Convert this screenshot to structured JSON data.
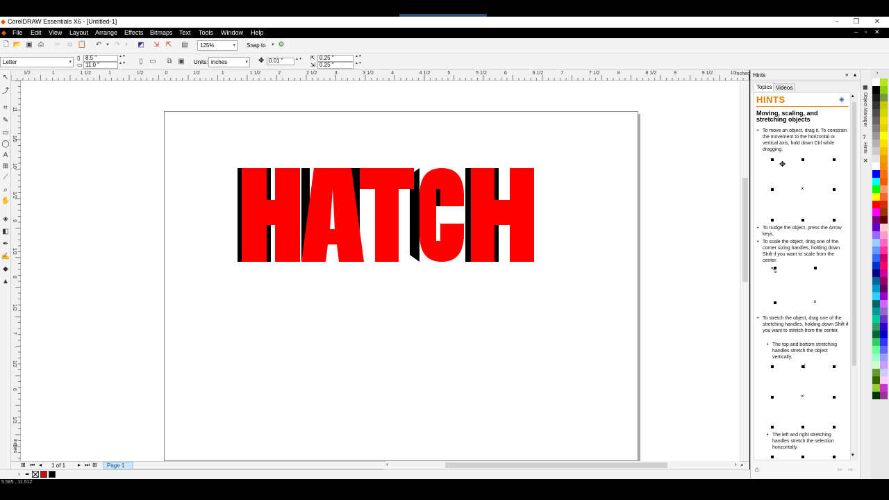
{
  "window": {
    "title": "CorelDRAW Essentials X6 - [Untitled-1]",
    "controls": [
      "–",
      "❐",
      "✕"
    ],
    "doc_controls": [
      "–",
      "▫",
      "✕"
    ]
  },
  "menu": {
    "items": [
      "File",
      "Edit",
      "View",
      "Layout",
      "Arrange",
      "Effects",
      "Bitmaps",
      "Text",
      "Tools",
      "Window",
      "Help"
    ]
  },
  "toolbar": {
    "zoom_value": "125%",
    "snap_to_label": "Snap to"
  },
  "property_bar": {
    "page_size": "Letter",
    "width": "8.5 \"",
    "height": "11.0 \"",
    "units_label": "Units:",
    "units_value": "inches",
    "nudge": "0.01 \"",
    "dup_x": "0.25 \"",
    "dup_y": "0.25 \""
  },
  "ruler": {
    "h_labels": [
      "1/2",
      "1",
      "1 1/2",
      "1",
      "1/2",
      "0",
      "1/2",
      "1",
      "1 1/2",
      "2",
      "2 1/2",
      "3",
      "3 1/2",
      "4",
      "4 1/2",
      "5",
      "5 1/2",
      "6",
      "6 1/2",
      "7",
      "7 1/2",
      "8",
      "8 1/2",
      "9",
      "9 1/2",
      "10"
    ],
    "h_unit": "inches",
    "v_labels": [
      "11",
      "1/2",
      "10",
      "1/2",
      "9",
      "1/2",
      "8",
      "1/2",
      "7",
      "1/2",
      "6",
      "1/2",
      "5"
    ],
    "v_unit": "inches"
  },
  "canvas": {
    "artwork_text": "HATCH",
    "fill_color": "#ff0000",
    "shadow_color": "#000000"
  },
  "page_nav": {
    "page_count": "1 of 1",
    "page_tab": "Page 1"
  },
  "status": {
    "coords": "5.585 , 11.512"
  },
  "docker": {
    "title": "Hints",
    "tabs": [
      "Topics",
      "Videos"
    ],
    "hints_heading": "HINTS",
    "section_title": "Moving, scaling, and stretching objects",
    "tip1": "To move an object, drag it. To constrain the movement to the horizontal or vertical axis, hold down Ctrl while dragging.",
    "tip2": "To nudge the object, press the Arrow keys.",
    "tip3": "To scale the object, drag one of the corner sizing handles, holding down Shift if you want to scale from the center.",
    "tip4": "To stretch the object, drag one of the stretching handles, holding down Shift if you want to stretch from the center.",
    "tip4a": "The top and bottom stretching handles stretch the object vertically.",
    "tip4b": "The left and right stretching handles stretch the selection horizontally."
  },
  "side_tabs": [
    "Object Manager",
    "Hints"
  ],
  "palette": {
    "colors": [
      "#ffffff",
      "#b5e61d",
      "#000000",
      "#8fce00",
      "#1a1a1a",
      "#7a9a3a",
      "#333333",
      "#c8c800",
      "#4d4d4d",
      "#d4d400",
      "#666666",
      "#f0e000",
      "#808080",
      "#e8d000",
      "#999999",
      "#ffff00",
      "#b3b3b3",
      "#ffe000",
      "#cccccc",
      "#f5c000",
      "#e6e6e6",
      "#f0a000",
      "#ffffff",
      "#ff8c00",
      "#0000ff",
      "#ff7000",
      "#00ffff",
      "#ff5a00",
      "#00ff00",
      "#ff9966",
      "#ffff00",
      "#ff6633",
      "#ff0000",
      "#cc3300",
      "#ff00ff",
      "#993300",
      "#800080",
      "#660000",
      "#6600cc",
      "#ffcccc",
      "#9966ff",
      "#ff99cc",
      "#99ccff",
      "#ff66cc",
      "#6699ff",
      "#ff3399",
      "#3366ff",
      "#cc0066",
      "#0033cc",
      "#ff0066",
      "#000080",
      "#cc0099",
      "#006699",
      "#990066",
      "#0099cc",
      "#660066",
      "#33ccff",
      "#9900cc",
      "#006666",
      "#cc66ff",
      "#009999",
      "#9966cc",
      "#00cc99",
      "#6633cc",
      "#339966",
      "#3300cc",
      "#006633",
      "#0000cc",
      "#33cc66",
      "#3333ff",
      "#66ff99",
      "#6666ff",
      "#99ffcc",
      "#9999ff",
      "#ccffcc",
      "#cc99ff",
      "#669933",
      "#ccccff",
      "#336600",
      "#ffccff",
      "#99cc33",
      "#cc33cc",
      "#003300",
      "#993399"
    ]
  }
}
